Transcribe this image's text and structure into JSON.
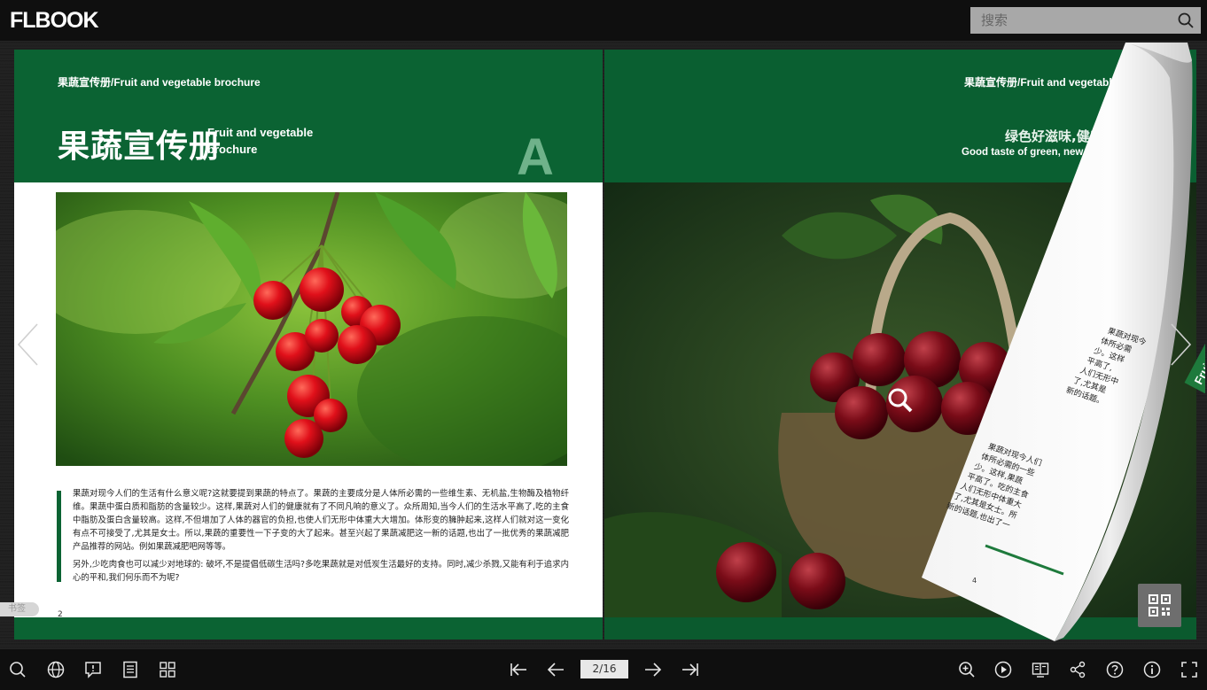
{
  "app": {
    "logo_text": "FLBOOK"
  },
  "search": {
    "placeholder": "搜索"
  },
  "left_page": {
    "header_small": "果蔬宣传册/Fruit and vegetable brochure",
    "title_cn": "果蔬宣传册",
    "title_en": "Fruit and vegetable brochure",
    "letter": "A",
    "paragraph1": "果蔬对现今人们的生活有什么意义呢?这就要提到果蔬的特点了。果蔬的主要成分是人体所必需的一些维生素、无机盐,生物酶及植物纤维。果蔬中蛋白质和脂肪的含量较少。这样,果蔬对人们的健康就有了不同凡响的意义了。众所周知,当今人们的生活水平高了,吃的主食中脂肪及蛋白含量较高。这样,不但增加了人体的器官的负担,也使人们无形中体重大大增加。体形变的臃肿起来,这样人们就对这一变化有点不可接受了,尤其是女士。所以,果蔬的重要性一下子变的大了起来。甚至兴起了果蔬减肥这一新的话题,也出了一批优秀的果蔬减肥产品推荐的网站。例如果蔬减肥吧网等等。",
    "paragraph2": "另外,少吃肉食也可以减少对地球的: 破坏,不是提倡低碳生活吗?多吃果蔬就是对低炭生活最好的支持。同时,减少杀戮,又能有利于追求内心的平和,我们何乐而不为呢?",
    "page_number": "2"
  },
  "right_page": {
    "header_small": "果蔬宣传册/Fruit and vegetable brochure",
    "slogan_cn": "绿色好滋味,健康新",
    "slogan_en": "Good taste of green, new power o"
  },
  "curl_page": {
    "heading": "Fruit and",
    "lines": [
      "果蔬对现今",
      "体所必需",
      "少。这样",
      "平高了,",
      "人们无形中",
      "了,尤其是",
      "新的话题。"
    ],
    "lines2": [
      "果蔬对现今人们",
      "体所必需的一些",
      "少。这样,果蔬",
      "平高了。吃的主食",
      "人们无形中体重大",
      "了,尤其是女士。所",
      "新的话题,也出了一"
    ],
    "page_number": "4"
  },
  "tag_left": "书签",
  "toolbar": {
    "page_indicator": "2/16"
  },
  "colors": {
    "brand_green": "#0b6333",
    "bar_bg": "#0f0f0f"
  }
}
